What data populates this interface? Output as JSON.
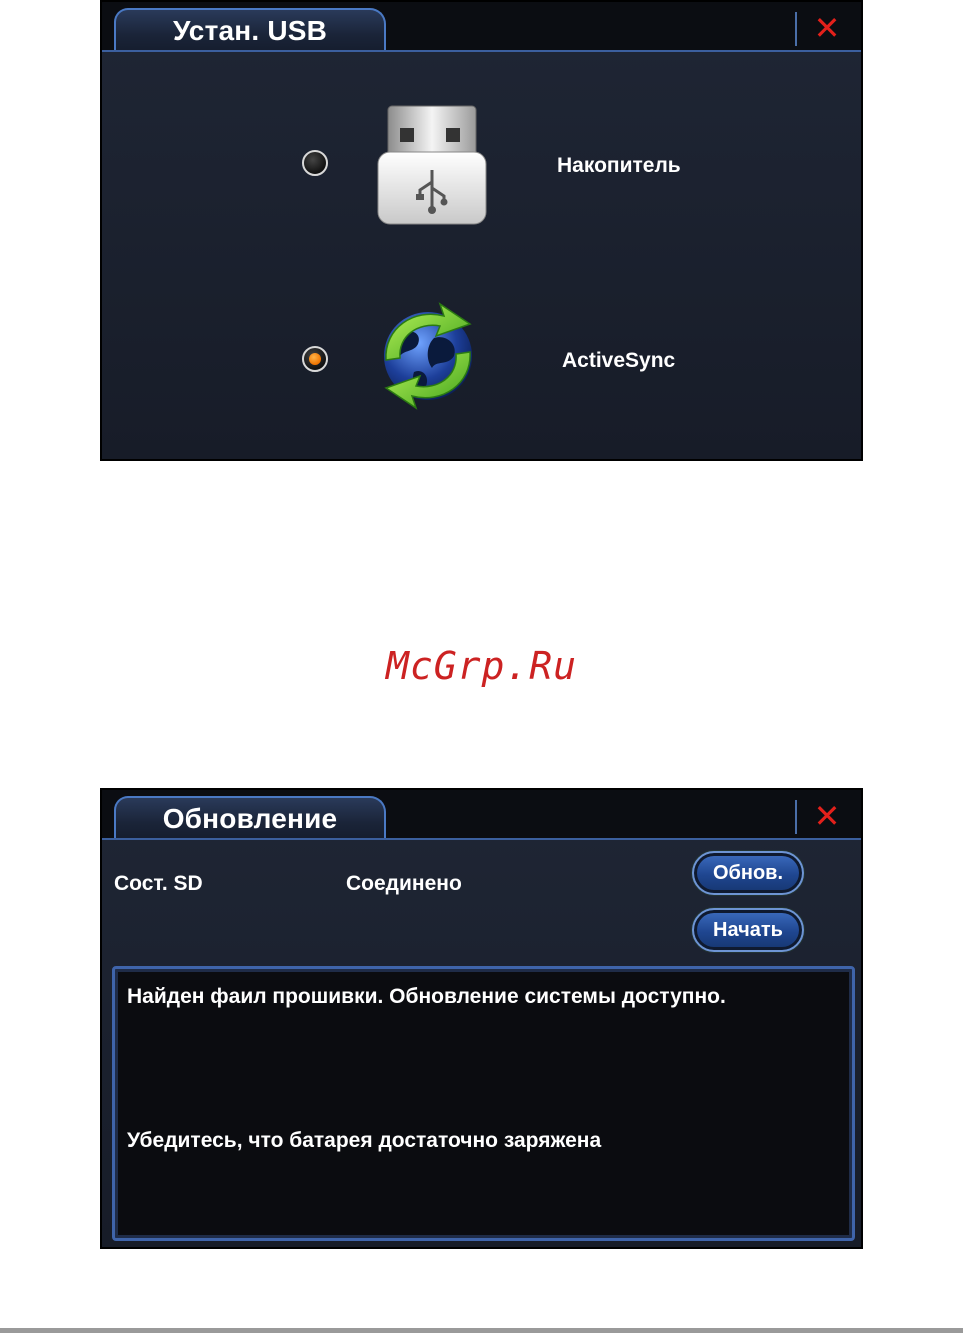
{
  "usb_dialog": {
    "title": "Устан. USB",
    "close_glyph": "✕",
    "options": [
      {
        "label": "Накопитель",
        "icon": "usb-drive-icon",
        "selected": false
      },
      {
        "label": "ActiveSync",
        "icon": "sync-globe-icon",
        "selected": true
      }
    ]
  },
  "watermark": "McGrp.Ru",
  "update_dialog": {
    "title": "Обновление",
    "close_glyph": "✕",
    "sd_status_label": "Сост. SD",
    "sd_status_value": "Соединено",
    "refresh_button": "Обнов.",
    "start_button": "Начать",
    "messages": [
      "Найден фаил прошивки. Обновление системы доступно.",
      "Убедитесь, что батарея достаточно заряжена"
    ]
  },
  "colors": {
    "panel_bg": "#1c2230",
    "accent_blue": "#4a79c4",
    "close_red": "#e3201b",
    "radio_selected": "#f07400",
    "watermark": "#cc2222"
  }
}
